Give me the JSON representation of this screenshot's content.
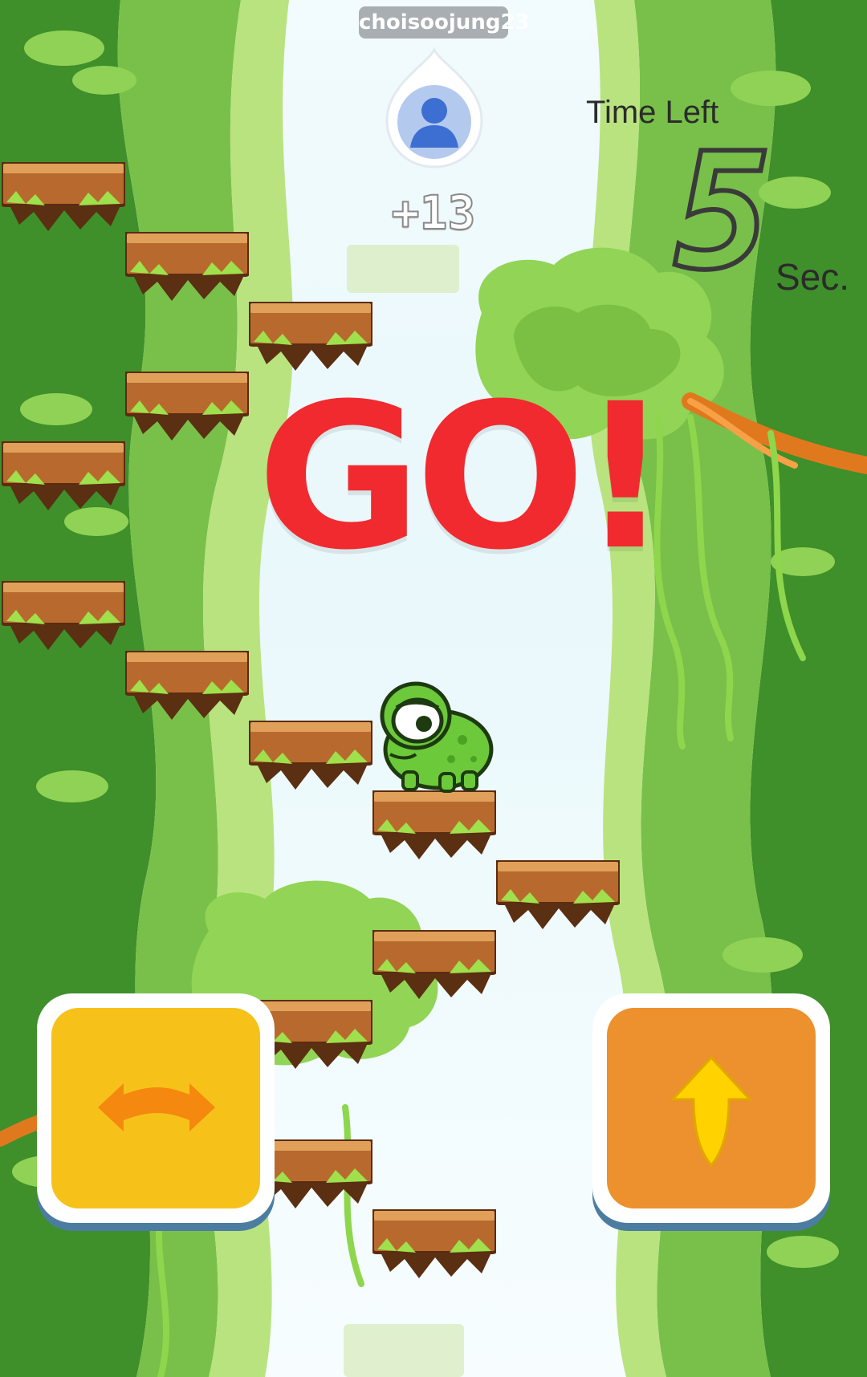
{
  "player": {
    "username": "choisoojung23",
    "avatar_icon": "user-avatar-icon",
    "score_delta": "+13"
  },
  "timer": {
    "label": "Time Left",
    "value": "5",
    "unit": "Sec."
  },
  "banner": {
    "text": "GO!",
    "color": "#f02a2f"
  },
  "controls": {
    "turn_icon": "turn-arrows-icon",
    "jump_icon": "up-arrow-icon",
    "turn_color": "#f6c21a",
    "jump_color": "#ec912d"
  }
}
